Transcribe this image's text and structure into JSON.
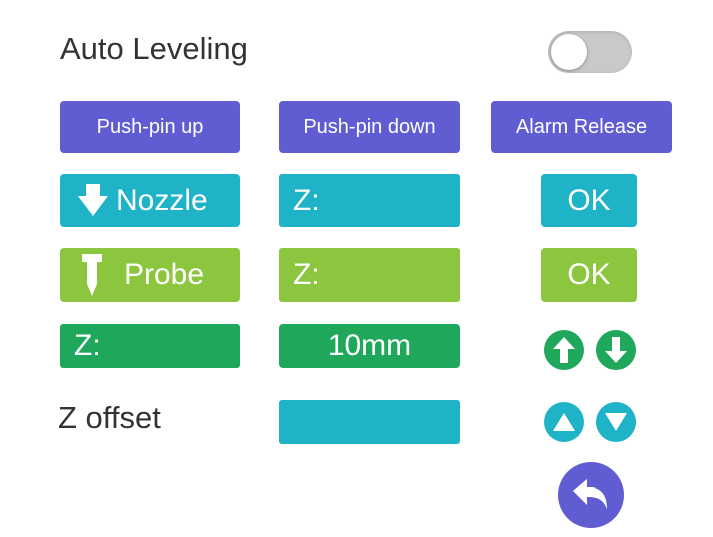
{
  "title": "Auto Leveling",
  "auto_leveling_enabled": false,
  "buttons": {
    "push_pin_up": "Push-pin up",
    "push_pin_down": "Push-pin down",
    "alarm_release": "Alarm Release",
    "nozzle": "Nozzle",
    "probe": "Probe",
    "ok_nozzle": "OK",
    "ok_probe": "OK"
  },
  "fields": {
    "nozzle_z": "Z:",
    "probe_z": "Z:",
    "z_value": "Z:",
    "step": "10mm",
    "z_offset_value": ""
  },
  "labels": {
    "z_offset": "Z offset"
  },
  "icons": {
    "nozzle": "arrow-down-nozzle-icon",
    "probe": "probe-icon",
    "up": "arrow-up-circle-icon",
    "down": "arrow-down-circle-icon",
    "tri_up": "triangle-up-icon",
    "tri_down": "triangle-down-icon",
    "back": "back-return-icon"
  },
  "colors": {
    "purple": "#5f5dd1",
    "teal": "#1fb3c7",
    "lime": "#8cc63f",
    "green": "#1fa85b"
  }
}
